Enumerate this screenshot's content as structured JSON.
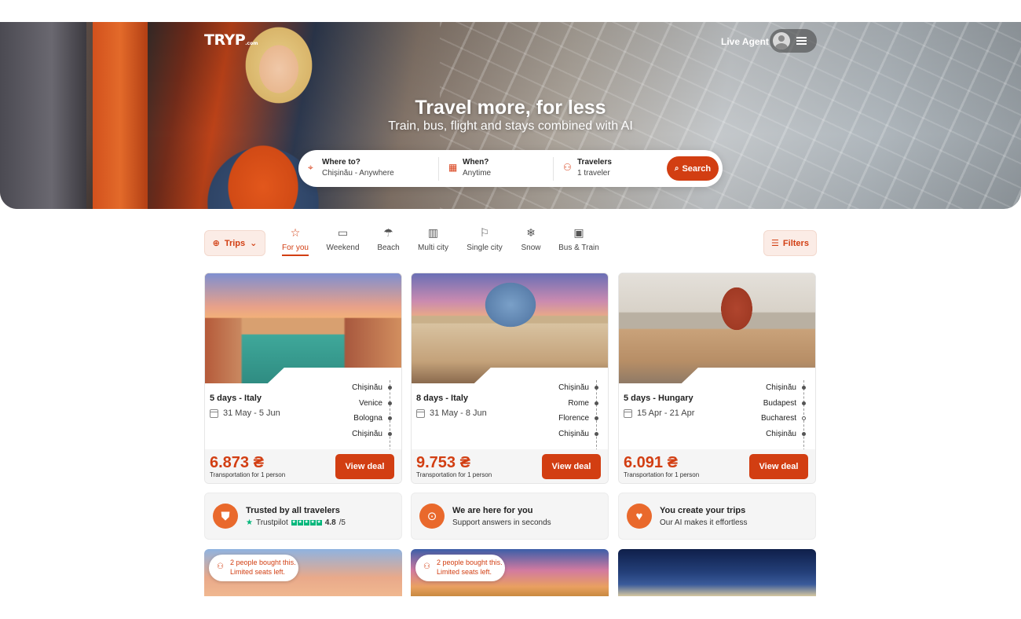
{
  "header": {
    "logo": "TRYP",
    "logo_suffix": ".com",
    "live_agent": "Live Agent"
  },
  "hero": {
    "title": "Travel more, for less",
    "subtitle": "Train, bus, flight and stays combined with AI"
  },
  "search": {
    "where_label": "Where to?",
    "where_value": "Chișinău - Anywhere",
    "when_label": "When?",
    "when_value": "Anytime",
    "travelers_label": "Travelers",
    "travelers_value": "1 traveler",
    "button": "Search"
  },
  "filters": {
    "trips": "Trips",
    "filters": "Filters",
    "categories": [
      {
        "label": "For you",
        "icon": "star-icon",
        "active": true
      },
      {
        "label": "Weekend",
        "icon": "calendar-icon",
        "active": false
      },
      {
        "label": "Beach",
        "icon": "palm-icon",
        "active": false
      },
      {
        "label": "Multi city",
        "icon": "buildings-icon",
        "active": false
      },
      {
        "label": "Single city",
        "icon": "signpost-icon",
        "active": false
      },
      {
        "label": "Snow",
        "icon": "snowflake-icon",
        "active": false
      },
      {
        "label": "Bus & Train",
        "icon": "train-icon",
        "active": false
      }
    ]
  },
  "deals": [
    {
      "days": "5 days - Italy",
      "dates": "31 May - 5 Jun",
      "stops": [
        "Chișinău",
        "Venice",
        "Bologna",
        "Chișinău"
      ],
      "price": "6.873 ₴",
      "price_note": "Transportation for 1 person",
      "button": "View deal"
    },
    {
      "days": "8 days - Italy",
      "dates": "31 May - 8 Jun",
      "stops": [
        "Chișinău",
        "Rome",
        "Florence",
        "Chișinău"
      ],
      "price": "9.753 ₴",
      "price_note": "Transportation for 1 person",
      "button": "View deal"
    },
    {
      "days": "5 days - Hungary",
      "dates": "15 Apr - 21 Apr",
      "stops": [
        "Chișinău",
        "Budapest",
        "Bucharest",
        "Chișinău"
      ],
      "price": "6.091 ₴",
      "price_note": "Transportation for 1 person",
      "button": "View deal"
    }
  ],
  "info": [
    {
      "title": "Trusted by all travelers",
      "trustpilot": "Trustpilot",
      "rating": "4.8",
      "rating_max": "/5"
    },
    {
      "title": "We are here for you",
      "subtitle": "Support answers in seconds"
    },
    {
      "title": "You create your trips",
      "subtitle": "Our AI makes it effortless"
    }
  ],
  "badges": {
    "line1": "2 people bought this.",
    "line2": "Limited seats left."
  },
  "colors": {
    "accent": "#d23e12",
    "accent_light": "#fbece6"
  }
}
